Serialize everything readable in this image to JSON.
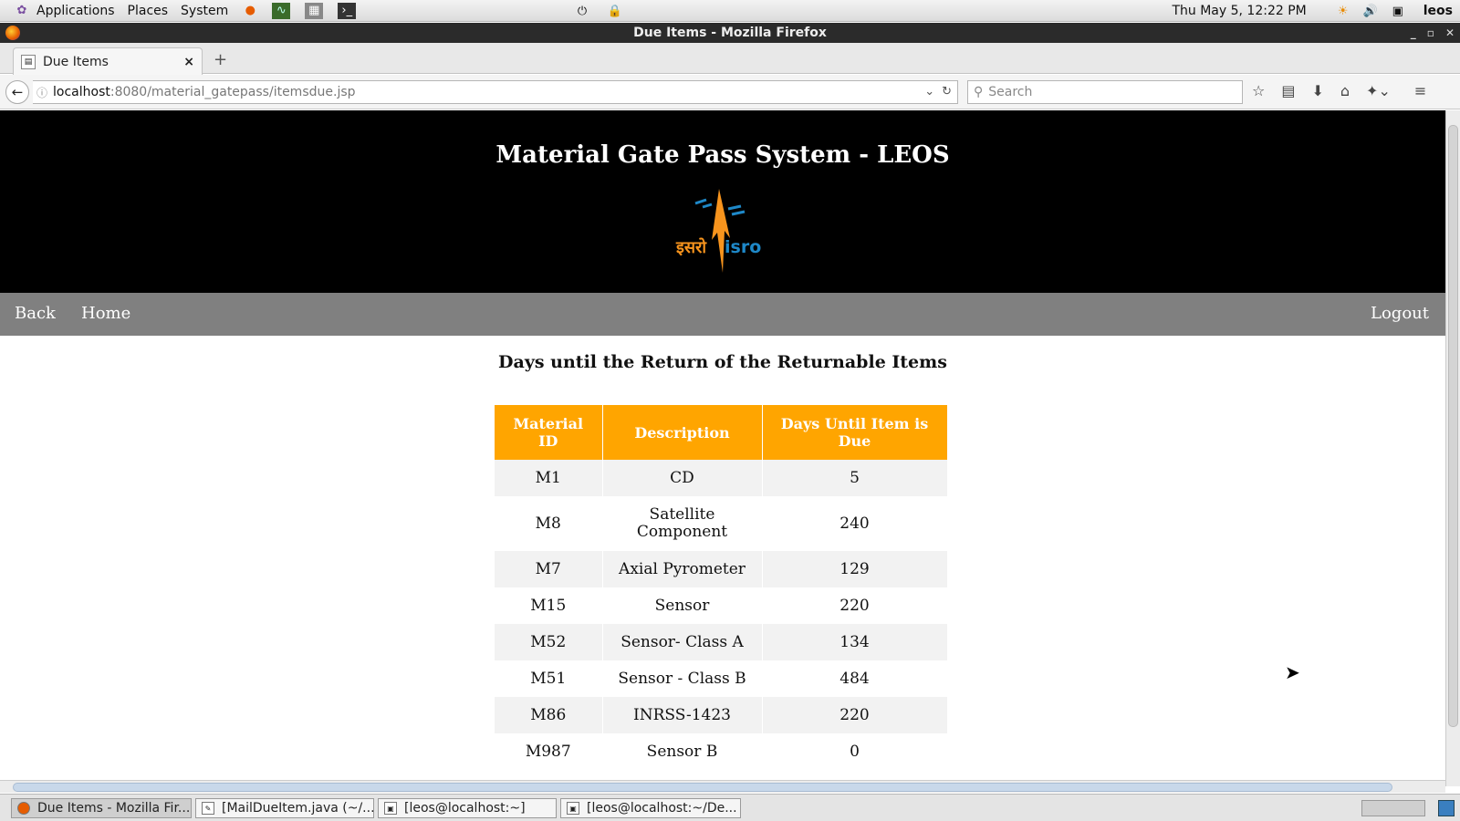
{
  "panel": {
    "applications": "Applications",
    "places": "Places",
    "system": "System",
    "clock": "Thu May  5, 12:22 PM",
    "user": "leos"
  },
  "window": {
    "title": "Due Items - Mozilla Firefox"
  },
  "browser": {
    "tab_title": "Due Items",
    "url_host": "localhost",
    "url_rest": ":8080/material_gatepass/itemsdue.jsp",
    "search_placeholder": "Search"
  },
  "page": {
    "site_title": "Material Gate Pass System - LEOS",
    "logo_text_hindi": "इसरो",
    "logo_text_latin": "isro",
    "nav": {
      "back": "Back",
      "home": "Home",
      "logout": "Logout"
    },
    "heading": "Days until the Return of the Returnable Items",
    "table": {
      "headers": [
        "Material ID",
        "Description",
        "Days Until Item is Due"
      ],
      "rows": [
        [
          "M1",
          "CD",
          "5"
        ],
        [
          "M8",
          "Satellite Component",
          "240"
        ],
        [
          "M7",
          "Axial Pyrometer",
          "129"
        ],
        [
          "M15",
          "Sensor",
          "220"
        ],
        [
          "M52",
          "Sensor- Class A",
          "134"
        ],
        [
          "M51",
          "Sensor - Class B",
          "484"
        ],
        [
          "M86",
          "INRSS-1423",
          "220"
        ],
        [
          "M987",
          "Sensor B",
          "0"
        ]
      ]
    }
  },
  "taskbar": {
    "tasks": [
      "Due Items - Mozilla Fir...",
      "[MailDueItem.java (~/...",
      "[leos@localhost:~]",
      "[leos@localhost:~/De..."
    ]
  },
  "colors": {
    "table_header": "#ffa500",
    "menu_bar": "#808080",
    "header_bg": "#000000",
    "logo_orange": "#f7941d",
    "logo_blue": "#1e88c8"
  }
}
